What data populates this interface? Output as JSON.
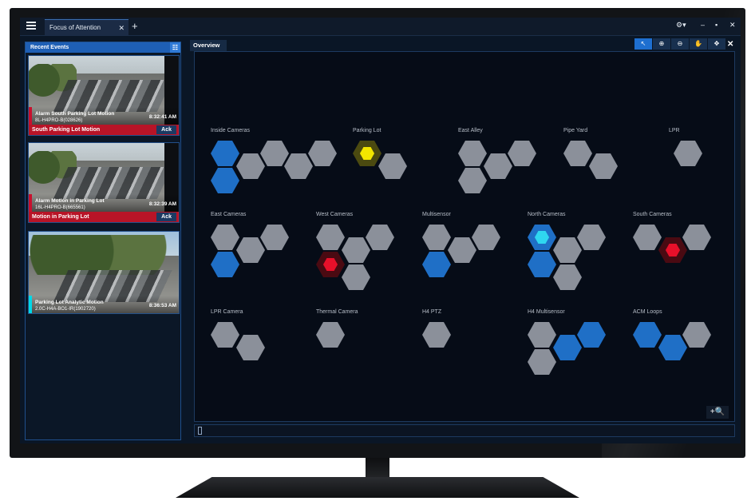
{
  "window": {
    "tab_title": "Focus of Attention",
    "tab_close": "✕",
    "add_tab": "+",
    "controls": {
      "settings": "⚙▾",
      "minimize": "–",
      "maximize": "▪",
      "close": "✕"
    }
  },
  "events_panel": {
    "title": "Recent Events",
    "items": [
      {
        "title": "Alarm South Parking Lot Motion",
        "camera": "8L-H4PRO-B(028626)",
        "time": "8:32:41 AM",
        "bar_label": "South Parking Lot Motion",
        "ack": "Ack",
        "accent": "#c8102e"
      },
      {
        "title": "Alarm Motion in Parking Lot",
        "camera": "16L-H4PRO-B(665561)",
        "time": "8:32:39 AM",
        "bar_label": "Motion in Parking Lot",
        "ack": "Ack",
        "accent": "#c8102e"
      },
      {
        "title": "Parking Lot Analytic Motion",
        "camera": "2.0C-H4A-BO1-IR(1902720)",
        "time": "8:36:53 AM",
        "accent": "#00d8e8"
      }
    ]
  },
  "overview": {
    "tab": "Overview",
    "close": "✕",
    "tools": [
      {
        "name": "select-tool",
        "glyph": "↖"
      },
      {
        "name": "zoom-in-tool",
        "glyph": "⊕"
      },
      {
        "name": "zoom-out-tool",
        "glyph": "⊖"
      },
      {
        "name": "pan-tool",
        "glyph": "✋"
      },
      {
        "name": "move-tool",
        "glyph": "✥"
      }
    ],
    "zoom_button": "+🔍",
    "groups": [
      {
        "label": "Inside Cameras"
      },
      {
        "label": "Parking Lot"
      },
      {
        "label": "East Alley"
      },
      {
        "label": "Pipe Yard"
      },
      {
        "label": "LPR"
      },
      {
        "label": "East Cameras"
      },
      {
        "label": "West Cameras"
      },
      {
        "label": "Multisensor"
      },
      {
        "label": "North Cameras"
      },
      {
        "label": "South Cameras"
      },
      {
        "label": "LPR Camera"
      },
      {
        "label": "Thermal Camera"
      },
      {
        "label": "H4 PTZ"
      },
      {
        "label": "H4 Multisensor"
      },
      {
        "label": "ACM Loops"
      }
    ]
  },
  "colors": {
    "hex_grey": "#8b909a",
    "hex_blue": "#1f6fc6",
    "alarm_red": "#e8102a",
    "alarm_yellow": "#f2e600",
    "alarm_cyan": "#2fd6f0",
    "panel_accent": "#1e5fb5"
  }
}
